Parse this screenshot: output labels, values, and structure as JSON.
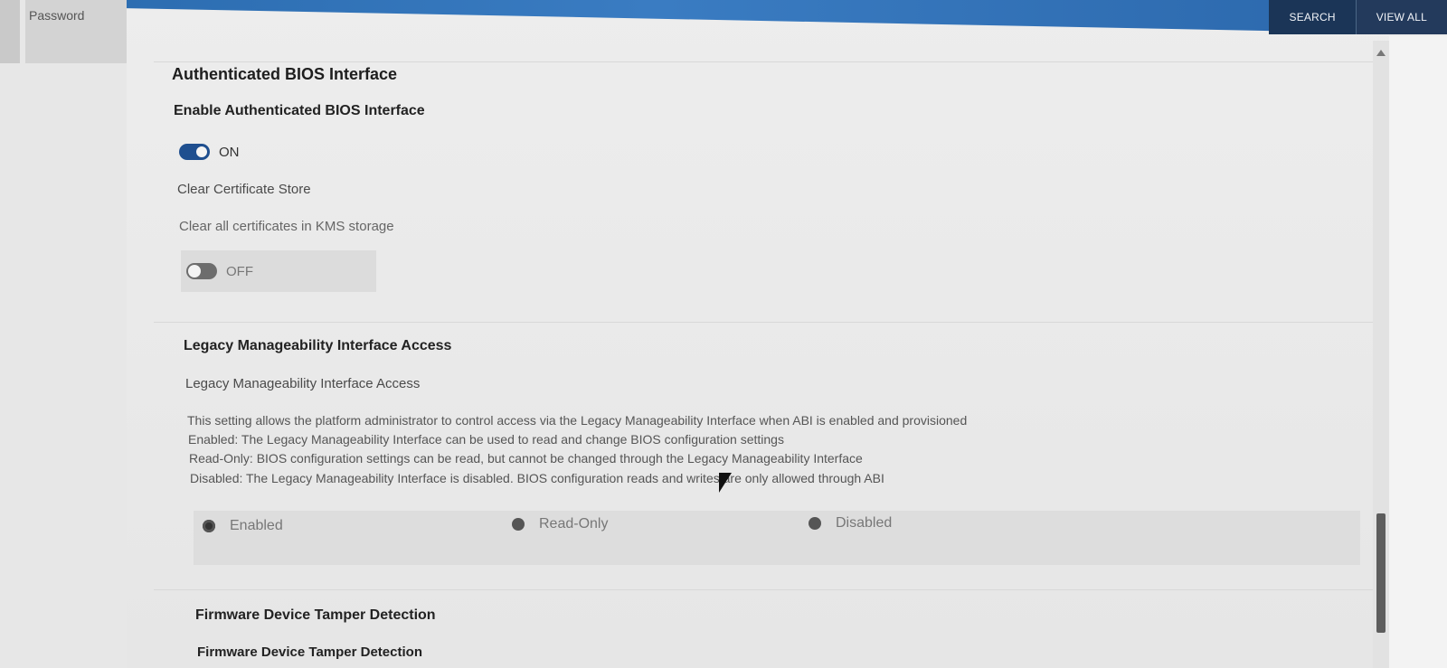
{
  "sidebar": {
    "items": [
      {
        "label": "Password"
      }
    ]
  },
  "header": {
    "search_label": "SEARCH",
    "view_all_label": "VIEW ALL"
  },
  "sections": {
    "abi": {
      "title": "Authenticated BIOS Interface",
      "enable": {
        "title": "Enable Authenticated BIOS Interface",
        "state_label": "ON",
        "value": true
      },
      "clear_store": {
        "title": "Clear Certificate Store",
        "description": "Clear all certificates in KMS storage",
        "state_label": "OFF",
        "value": false
      }
    },
    "legacy": {
      "title": "Legacy Manageability Interface Access",
      "setting_label": "Legacy Manageability Interface Access",
      "description_lines": [
        "This setting allows the platform administrator to control access via the Legacy Manageability Interface when ABI is enabled and provisioned",
        "Enabled: The Legacy Manageability Interface can be used to read and change BIOS configuration settings",
        "Read-Only: BIOS configuration settings can be read, but cannot be changed through the Legacy Manageability Interface",
        "Disabled: The Legacy Manageability Interface is disabled. BIOS configuration reads and writes are only allowed through ABI"
      ],
      "options": [
        "Enabled",
        "Read-Only",
        "Disabled"
      ],
      "selected": "Enabled"
    },
    "firmware": {
      "title": "Firmware Device Tamper Detection",
      "setting_label": "Firmware Device Tamper Detection"
    }
  },
  "colors": {
    "topbar": "#2c6db1",
    "toggle_on": "#1f4f8f"
  }
}
